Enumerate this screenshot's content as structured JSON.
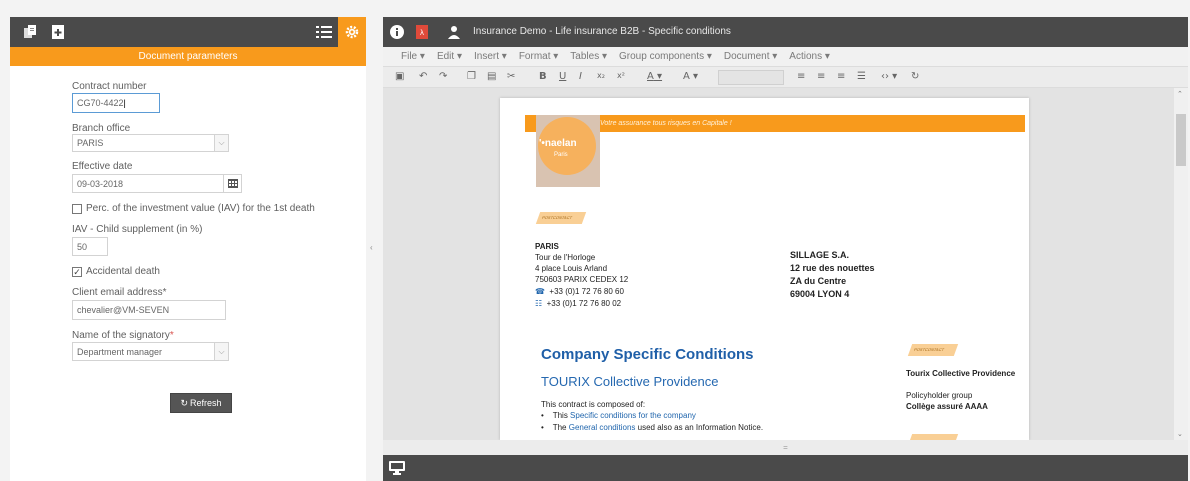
{
  "left_panel": {
    "header_title": "Document parameters",
    "fields": {
      "contract_number": {
        "label": "Contract number",
        "value": "CG70-4422"
      },
      "branch_office": {
        "label": "Branch office",
        "value": "PARIS"
      },
      "effective_date": {
        "label": "Effective date",
        "value": "09-03-2018"
      },
      "iav_checkbox": {
        "label": "Perc. of the investment value (IAV) for the 1st death",
        "checked": false
      },
      "iav_child": {
        "label": "IAV - Child supplement (in %)",
        "value": "50"
      },
      "accidental_death": {
        "label": "Accidental death",
        "checked": true,
        "mark": "✓"
      },
      "client_email": {
        "label": "Client email address",
        "required_mark": "*",
        "value": "chevalier@VM-SEVEN"
      },
      "signatory": {
        "label": "Name of the signatory",
        "required_mark": "*",
        "value": "Department manager"
      }
    },
    "refresh_label": "Refresh"
  },
  "right_panel": {
    "window_title": "Insurance Demo - Life insurance B2B - Specific conditions",
    "menus": [
      "File",
      "Edit",
      "Insert",
      "Format",
      "Tables",
      "Group components",
      "Document",
      "Actions"
    ],
    "toolbar": [
      "B",
      "U",
      "I",
      "x₂",
      "x²",
      "A",
      "A"
    ]
  },
  "document": {
    "banner_text": "Votre assurance tous risques en Capitale !",
    "logo_text": "naelan",
    "logo_sub": "Paris",
    "tag_text": "POSTCONTACT",
    "sender": {
      "city": "PARIS",
      "line1": "Tour de l'Horloge",
      "line2": "4 place Louis Arland",
      "line3": "750603 PARIX CEDEX 12",
      "phone": "+33 (0)1 72 76 80 60",
      "fax": "+33 (0)1 72 76 80 02"
    },
    "recipient": {
      "name": "SILLAGE S.A.",
      "line1": "12 rue des nouettes",
      "line2": "ZA du Centre",
      "line3": "69004 LYON 4"
    },
    "title": "Company Specific Conditions",
    "subtitle": "TOURIX Collective Providence",
    "composed_intro": "This contract is composed of:",
    "bullet1_prefix": "This ",
    "bullet1_link": "Specific conditions for the company",
    "bullet2_prefix": "The ",
    "bullet2_link": "General conditions",
    "bullet2_suffix": " used also as an Information Notice.",
    "side_product": "Tourix Collective Providence",
    "side_group_label": "Policyholder group",
    "side_group_value": "Collège assuré AAAA"
  },
  "colors": {
    "accent": "#f89a1c",
    "dark_bar": "#4a4a4a",
    "link_blue": "#2166ad"
  }
}
